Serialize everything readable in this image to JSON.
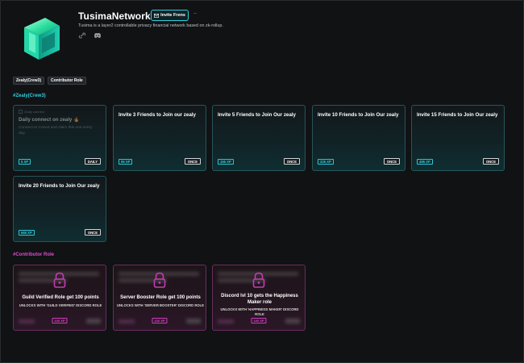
{
  "header": {
    "title": "TusimaNetwork",
    "invite_label": "Invite Frens",
    "dash": "–",
    "description": "Tusima is a layer2 controllable privacy financial network based on zk-rollup."
  },
  "icons": {
    "invite": "mail-icon",
    "link": "link-icon",
    "discord": "discord-icon",
    "lock": "lock-icon"
  },
  "tags": [
    "Zealy(Crew3)",
    "Contributor Role"
  ],
  "sections": {
    "zealy": {
      "title": "#Zealy(Crew3)",
      "color": "#2fd0e0",
      "cards": [
        {
          "top": "Zealy connect",
          "title": "Daily connect on zealy",
          "sub": "Connect to Crew3 and claim this one every day.",
          "xp": "5 XP",
          "badge": "DAILY"
        },
        {
          "title": "Invite 3 Friends to Join our zealy",
          "xp": "95 XP",
          "badge": "ONCE"
        },
        {
          "title": "Invite 5 Friends to Join Our zealy",
          "xp": "155 XP",
          "badge": "ONCE"
        },
        {
          "title": "Invite 10 Friends to Join Our zealy",
          "xp": "325 XP",
          "badge": "ONCE"
        },
        {
          "title": "Invite 15 Friends to Join Our zealy",
          "xp": "495 XP",
          "badge": "ONCE"
        },
        {
          "title": "Invite 20 Friends to Join Our zealy",
          "xp": "665 XP",
          "badge": "ONCE"
        }
      ]
    },
    "contributor": {
      "title": "#Contributor Role",
      "color": "#e04ad0",
      "cards": [
        {
          "title": "Guild Verified Role get 100 points",
          "sub": "UNLOCKS WITH 'GUILD VERIFIED' DISCORD ROLE",
          "xp": "100 XP"
        },
        {
          "title": "Server Booster Role get 100 points",
          "sub": "UNLOCKS WITH 'SERVER BOOSTER' DISCORD ROLE",
          "xp": "100 XP"
        },
        {
          "title": "Discord lvl 10 gets the Happiness Maker role",
          "sub": "UNLOCKS WITH 'HAPPINESS MAKER' DISCORD ROLE",
          "xp": "100 XP"
        }
      ]
    }
  }
}
